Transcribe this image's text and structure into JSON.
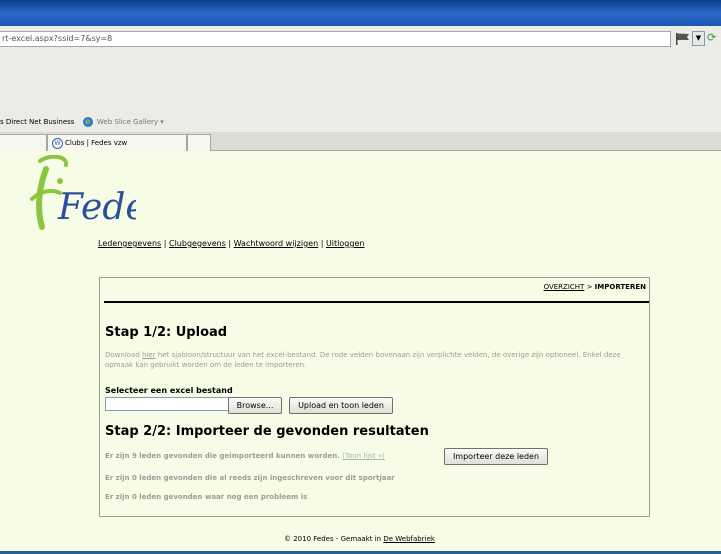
{
  "browser": {
    "address": "rt-excel.aspx?ssid=7&sy=8",
    "favorites": {
      "item1": "s Direct Net Business",
      "item2": "Web Slice Gallery ▾"
    },
    "tab_title": "Clubs | Fedes vzw"
  },
  "site": {
    "logo_text": "Fedes",
    "nav": {
      "item1": "Ledengegevens",
      "item2": "Clubgegevens",
      "item3": "Wachtwoord wijzigen",
      "item4": "Uitloggen",
      "separator": "|"
    }
  },
  "breadcrumb": {
    "link": "OVERZICHT",
    "separator": ">",
    "current": "IMPORTEREN"
  },
  "step1": {
    "title": "Stap 1/2: Upload",
    "desc_before": "Download ",
    "desc_link": "hier",
    "desc_after": " het sjabloon/structuur van het excel-bestand. De rode velden bovenaan zijn verplichte velden, de overige zijn optioneel. Enkel deze opmaak kan gebruikt worden om de leden te importeren.",
    "select_label": "Selecteer een excel bestand",
    "file_value": "",
    "browse_label": "Browse...",
    "upload_label": "Upload en toon leden"
  },
  "step2": {
    "title": "Stap 2/2: Importeer de gevonden resultaten",
    "line1": "Er zijn 9 leden gevonden die geimporteerd kunnen worden.",
    "toon_link": "(Toon lijst »)",
    "import_label": "Importeer deze leden",
    "line2": "Er zijn 0 leden gevonden die al reeds zijn ingeschreven voor dit sportjaar",
    "line3": "Er zijn 0 leden gevonden waar nog een probleem is"
  },
  "footer": {
    "text": "© 2010 Fedes - Gemaakt in ",
    "link": "De Webfabriek"
  },
  "colors": {
    "page_bg": "#f7fce6",
    "muted_text": "#9b9e95",
    "logo_green": "#8cc63f",
    "logo_blue": "#2b4f9e"
  }
}
